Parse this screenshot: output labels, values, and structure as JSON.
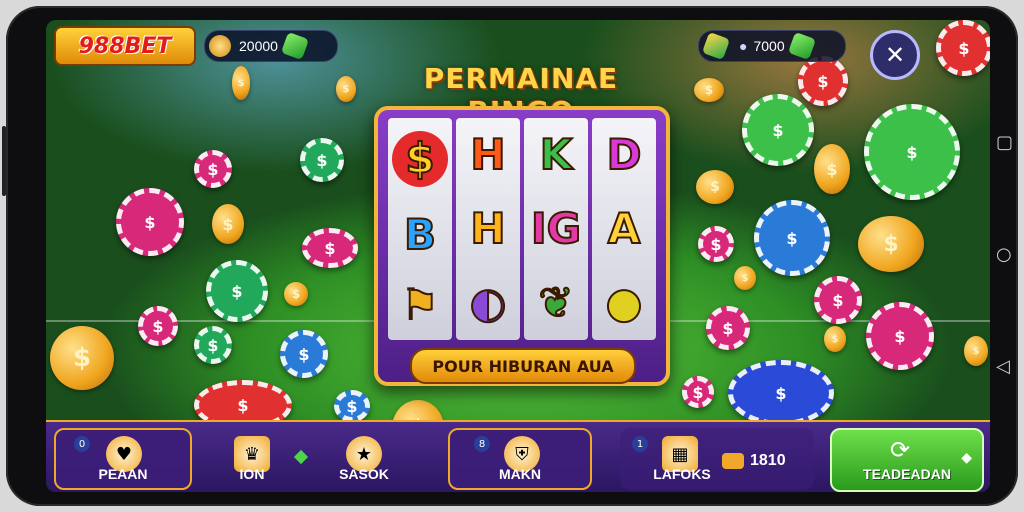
{
  "header": {
    "logo_text": "988BET",
    "balance_left": "20000",
    "balance_right": "7000",
    "close_icon": "close-icon"
  },
  "game": {
    "title": "PERMAINAE BINGO",
    "reels": [
      [
        "$",
        "B",
        "⚑"
      ],
      [
        "H",
        "H",
        "◐"
      ],
      [
        "K",
        "IG",
        "❦"
      ],
      [
        "D",
        "A",
        "●"
      ]
    ],
    "banner": "POUR HIBURAN AUA"
  },
  "bottom_bar": {
    "tabs": [
      {
        "label": "PEAAN",
        "icon": "heart-icon",
        "badge": "0"
      },
      {
        "label": "ION",
        "icon": "trophy-icon"
      },
      {
        "label": "SASOK",
        "icon": "star-icon"
      },
      {
        "label": "MAKN",
        "icon": "shield-icon",
        "badge": "8"
      },
      {
        "label": "LAFOKS",
        "icon": "store-icon",
        "badge": "1"
      }
    ],
    "coin_count": "1810",
    "cta_label": "TEADEADAN"
  },
  "colors": {
    "accent": "#f0a82a",
    "brand_red": "#e21b1b",
    "cta_green": "#2a9a1e",
    "panel_purple": "#4a2a8a"
  }
}
